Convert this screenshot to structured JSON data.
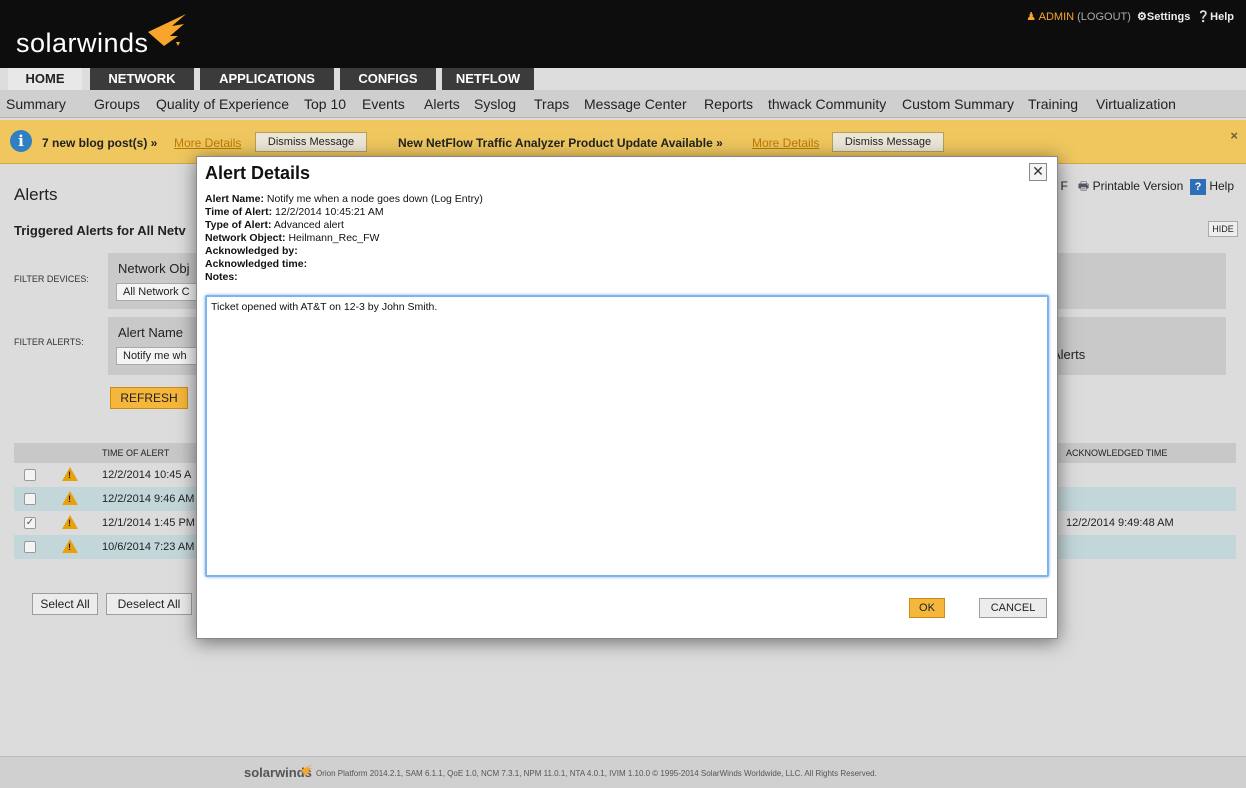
{
  "header": {
    "logo_text": "solarwinds",
    "user": "ADMIN",
    "logout": "(LOGOUT)",
    "settings": "Settings",
    "help": "Help"
  },
  "tabs": [
    "HOME",
    "NETWORK",
    "APPLICATIONS",
    "CONFIGS",
    "NETFLOW"
  ],
  "active_tab": "HOME",
  "subnav": [
    "Summary",
    "Groups",
    "Quality of Experience",
    "Top 10",
    "Events",
    "Alerts",
    "Syslog",
    "Traps",
    "Message Center",
    "Reports",
    "thwack Community",
    "Custom Summary",
    "Training",
    "Virtualization"
  ],
  "banner": {
    "msg1": "7 new blog post(s) »",
    "link1": "More Details",
    "dismiss1": "Dismiss Message",
    "msg2": "New NetFlow Traffic Analyzer Product Update Available »",
    "link2": "More Details",
    "dismiss2": "Dismiss Message",
    "close": "×"
  },
  "page": {
    "title": "Alerts",
    "section_title": "Triggered Alerts for All Netv",
    "right_links_prefix": "F",
    "printable": "Printable Version",
    "help": "Help",
    "hide": "HIDE",
    "filter_devices_label": "FILTER DEVICES:",
    "filter_devices_title": "Network Obj",
    "filter_devices_value": "All Network C",
    "filter_alerts_label": "FILTER ALERTS:",
    "filter_alerts_title": "Alert Name",
    "filter_alerts_value": "Notify me wh",
    "filter_alerts_right": "Alerts",
    "refresh": "REFRESH",
    "col_time": "TIME OF ALERT",
    "col_ack_time": "ACKNOWLEDGED TIME",
    "select_all": "Select All",
    "deselect_all": "Deselect All"
  },
  "rows": [
    {
      "time": "12/2/2014 10:45 A",
      "ack_time": "",
      "checked": false
    },
    {
      "time": "12/2/2014 9:46 AM",
      "ack_time": "",
      "checked": false
    },
    {
      "time": "12/1/2014 1:45 PM",
      "ack_time": "12/2/2014 9:49:48 AM",
      "checked": true
    },
    {
      "time": "10/6/2014 7:23 AM",
      "ack_time": "",
      "checked": false
    }
  ],
  "dialog": {
    "title": "Alert Details",
    "alert_name_label": "Alert Name:",
    "alert_name": "Notify me when a node goes down (Log Entry)",
    "time_label": "Time of Alert:",
    "time": "12/2/2014 10:45:21 AM",
    "type_label": "Type of Alert:",
    "type": "Advanced alert",
    "object_label": "Network Object:",
    "object": "Heilmann_Rec_FW",
    "ack_by_label": "Acknowledged by:",
    "ack_time_label": "Acknowledged time:",
    "notes_label": "Notes:",
    "notes": "Ticket opened with AT&T on 12-3 by John Smith.",
    "ok": "OK",
    "cancel": "CANCEL"
  },
  "footer": {
    "logo": "solarwinds",
    "text": "Orion Platform 2014.2.1, SAM 6.1.1, QoE 1.0, NCM 7.3.1, NPM 11.0.1, NTA 4.0.1, IVIM 1.10.0 © 1995-2014 SolarWinds Worldwide, LLC. All Rights Reserved."
  }
}
